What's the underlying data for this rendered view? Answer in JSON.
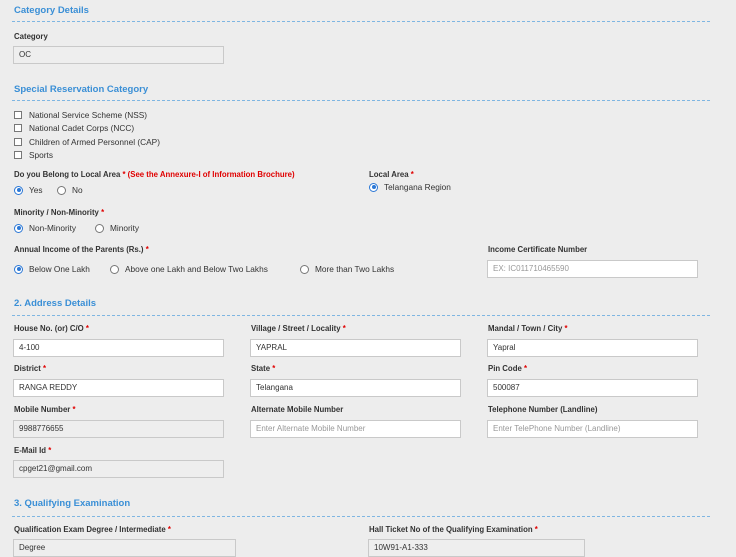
{
  "category_details": {
    "title": "Category Details",
    "category_label": "Category",
    "category_value": "OC"
  },
  "special_reservation": {
    "title": "Special Reservation Category",
    "options": [
      "National Service Scheme (NSS)",
      "National Cadet Corps (NCC)",
      "Children of Armed Personnel (CAP)",
      "Sports"
    ],
    "local_area_question": "Do you Belong to Local Area",
    "local_area_note": "(See the Annexure-I of Information Brochure)",
    "local_area_choices": [
      "Yes",
      "No"
    ],
    "local_area_selected": "Yes",
    "local_area_label": "Local Area",
    "local_area_region": "Telangana Region",
    "minority_label": "Minority / Non-Minority",
    "minority_choices": [
      "Non-Minority",
      "Minority"
    ],
    "minority_selected": "Non-Minority",
    "income_label": "Annual Income of the Parents (Rs.)",
    "income_choices": [
      "Below One Lakh",
      "Above one Lakh and Below Two Lakhs",
      "More than Two Lakhs"
    ],
    "income_selected": "Below One Lakh",
    "income_cert_label": "Income Certificate Number",
    "income_cert_placeholder": "EX: IC011710465590"
  },
  "address": {
    "title": "2. Address Details",
    "house_label": "House No. (or) C/O",
    "house_value": "4-100",
    "village_label": "Village / Street / Locality",
    "village_value": "YAPRAL",
    "mandal_label": "Mandal / Town / City",
    "mandal_value": "Yapral",
    "district_label": "District",
    "district_value": "RANGA REDDY",
    "state_label": "State",
    "state_value": "Telangana",
    "pin_label": "Pin Code",
    "pin_value": "500087",
    "mobile_label": "Mobile Number",
    "mobile_value": "9988776655",
    "alt_mobile_label": "Alternate Mobile Number",
    "alt_mobile_placeholder": "Enter Alternate Mobile Number",
    "telephone_label": "Telephone Number (Landline)",
    "telephone_placeholder": "Enter TelePhone Number (Landline)",
    "email_label": "E-Mail Id",
    "email_value": "cpget21@gmail.com"
  },
  "qualifying": {
    "title": "3. Qualifying Examination",
    "degree_label": "Qualification Exam Degree / Intermediate",
    "degree_value": "Degree",
    "hall_ticket_label": "Hall Ticket No of the Qualifying Examination",
    "hall_ticket_value": "10W91-A1-333"
  },
  "required_mark": "*",
  "colors": {
    "accent": "#3a8fd6",
    "required": "#e00000",
    "radio_selected": "#2b78d6"
  }
}
